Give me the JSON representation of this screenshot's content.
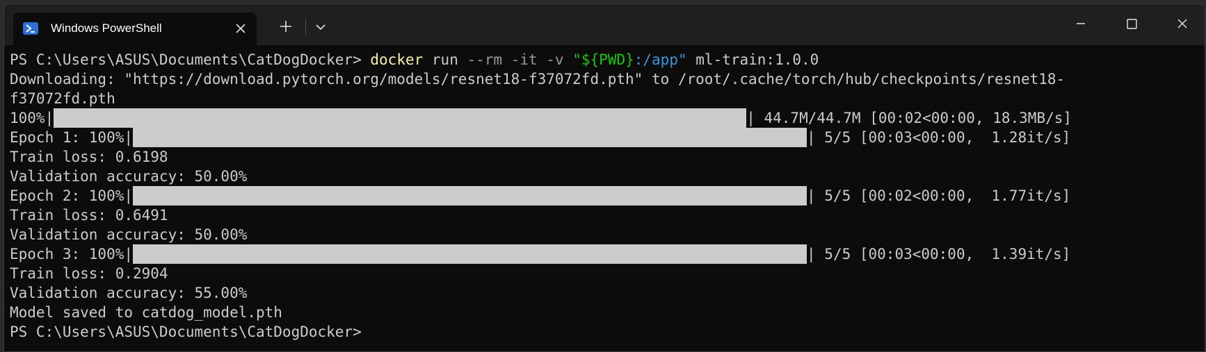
{
  "window": {
    "tab_title": "Windows PowerShell",
    "tab_icon": "powershell-icon",
    "new_tab_icon": "plus-icon",
    "dropdown_icon": "chevron-down-icon",
    "minimize_icon": "minimize-icon",
    "maximize_icon": "maximize-icon",
    "close_icon": "close-icon"
  },
  "colors": {
    "background": "#0c0c0c",
    "foreground": "#cccccc",
    "command": "#f9f1a5",
    "parameter": "#9a9a9a",
    "string": "#16c60c",
    "variable": "#3a96dd"
  },
  "terminal": {
    "command_line": {
      "prompt": "PS C:\\Users\\ASUS\\Documents\\CatDogDocker>",
      "cmd": "docker",
      "sub": "run",
      "flags": "--rm -it -v",
      "str_open": "\"",
      "str_var": "${PWD}",
      "str_path": ":/app",
      "str_close": "\"",
      "image": "ml-train:1.0.0"
    },
    "download_line_1": "Downloading: \"https://download.pytorch.org/models/resnet18-f37072fd.pth\" to /root/.cache/torch/hub/checkpoints/resnet18-",
    "download_line_2": "f37072fd.pth",
    "download_progress": {
      "prefix": "100%|",
      "stats": "| 44.7M/44.7M [00:02<00:00, 18.3MB/s]",
      "percent": 100
    },
    "epochs": [
      {
        "prefix": "Epoch 1: 100%|",
        "stats": "| 5/5 [00:03<00:00,  1.28it/s]",
        "percent": 100,
        "train_loss": "Train loss: 0.6198",
        "val_acc": "Validation accuracy: 50.00%"
      },
      {
        "prefix": "Epoch 2: 100%|",
        "stats": "| 5/5 [00:02<00:00,  1.77it/s]",
        "percent": 100,
        "train_loss": "Train loss: 0.6491",
        "val_acc": "Validation accuracy: 50.00%"
      },
      {
        "prefix": "Epoch 3: 100%|",
        "stats": "| 5/5 [00:03<00:00,  1.39it/s]",
        "percent": 100,
        "train_loss": "Train loss: 0.2904",
        "val_acc": "Validation accuracy: 55.00%"
      }
    ],
    "saved_line": "Model saved to catdog_model.pth",
    "final_prompt": "PS C:\\Users\\ASUS\\Documents\\CatDogDocker>"
  }
}
